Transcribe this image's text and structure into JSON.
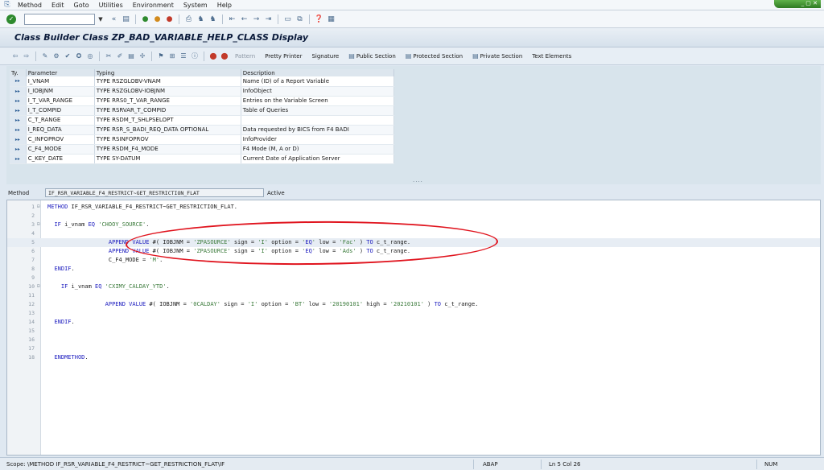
{
  "menu": [
    "Method",
    "Edit",
    "Goto",
    "Utilities",
    "Environment",
    "System",
    "Help"
  ],
  "title": "Class Builder Class ZP_BAD_VARIABLE_HELP_CLASS Display",
  "toolbar": {
    "pattern": "Pattern",
    "pretty_printer": "Pretty Printer",
    "signature": "Signature",
    "public_section": "Public Section",
    "protected_section": "Protected Section",
    "private_section": "Private Section",
    "text_elements": "Text Elements"
  },
  "params": {
    "headers": [
      "Ty.",
      "Parameter",
      "Typing",
      "Description"
    ],
    "rows": [
      {
        "parameter": "I_VNAM",
        "typing": "TYPE RSZGLOBV-VNAM",
        "description": "Name (ID) of a Report Variable"
      },
      {
        "parameter": "I_IOBJNM",
        "typing": "TYPE RSZGLOBV-IOBJNM",
        "description": "InfoObject"
      },
      {
        "parameter": "I_T_VAR_RANGE",
        "typing": "TYPE RRS0_T_VAR_RANGE",
        "description": "Entries on the Variable Screen"
      },
      {
        "parameter": "I_T_COMPID",
        "typing": "TYPE RSRVAR_T_COMPID",
        "description": "Table of Queries"
      },
      {
        "parameter": "C_T_RANGE",
        "typing": "TYPE RSDM_T_SHLPSELOPT",
        "description": ""
      },
      {
        "parameter": "I_REQ_DATA",
        "typing": "TYPE RSR_S_BADI_REQ_DATA OPTIONAL",
        "description": "Data requested by BICS from F4 BADI"
      },
      {
        "parameter": "C_INFOPROV",
        "typing": "TYPE RSINFOPROV",
        "description": "InfoProvider"
      },
      {
        "parameter": "C_F4_MODE",
        "typing": "TYPE RSDM_F4_MODE",
        "description": "F4 Mode (M, A or D)"
      },
      {
        "parameter": "C_KEY_DATE",
        "typing": "TYPE SY-DATUM",
        "description": "Current Date of Application Server"
      }
    ]
  },
  "method": {
    "label": "Method",
    "value": "IF_RSR_VARIABLE_F4_RESTRICT~GET_RESTRICTION_FLAT",
    "status": "Active"
  },
  "code_lines": [
    {
      "n": "1",
      "fold": "⊟",
      "text": "METHOD IF_RSR_VARIABLE_F4_RESTRICT~GET_RESTRICTION_FLAT."
    },
    {
      "n": "2",
      "fold": "",
      "text": ""
    },
    {
      "n": "3",
      "fold": "⊟",
      "text": "  IF i_vnam EQ 'CHOOY_SOURCE'."
    },
    {
      "n": "4",
      "fold": "",
      "text": ""
    },
    {
      "n": "5",
      "fold": "",
      "text": "                  APPEND VALUE #( IOBJNM = 'ZPASOURCE' sign = 'I' option = 'EQ' low = 'Fac' ) TO c_t_range."
    },
    {
      "n": "6",
      "fold": "",
      "text": "                  APPEND VALUE #( IOBJNM = 'ZPASOURCE' sign = 'I' option = 'EQ' low = 'Ads' ) TO c_t_range."
    },
    {
      "n": "7",
      "fold": "",
      "text": "                  C_F4_MODE = 'M'."
    },
    {
      "n": "8",
      "fold": "",
      "text": "  ENDIF."
    },
    {
      "n": "9",
      "fold": "",
      "text": ""
    },
    {
      "n": "10",
      "fold": "⊟",
      "text": "    IF i_vnam EQ 'CXIMY_CALDAY_YTD'."
    },
    {
      "n": "11",
      "fold": "",
      "text": ""
    },
    {
      "n": "12",
      "fold": "",
      "text": "                 APPEND VALUE #( IOBJNM = '0CALDAY' sign = 'I' option = 'BT' low = '20190101' high = '20210101' ) TO c_t_range."
    },
    {
      "n": "13",
      "fold": "",
      "text": ""
    },
    {
      "n": "14",
      "fold": "",
      "text": "  ENDIF."
    },
    {
      "n": "15",
      "fold": "",
      "text": ""
    },
    {
      "n": "16",
      "fold": "",
      "text": ""
    },
    {
      "n": "17",
      "fold": "",
      "text": ""
    },
    {
      "n": "18",
      "fold": "",
      "text": "  ENDMETHOD."
    }
  ],
  "status": {
    "scope": "Scope: \\METHOD IF_RSR_VARIABLE_F4_RESTRICT~GET_RESTRICTION_FLAT\\IF",
    "lang": "ABAP",
    "position": "Ln  5 Col  26",
    "num": "NUM"
  },
  "colors": {
    "annotation": "#e0141e",
    "keyword": "#2020c0",
    "string": "#3a7a3a"
  }
}
